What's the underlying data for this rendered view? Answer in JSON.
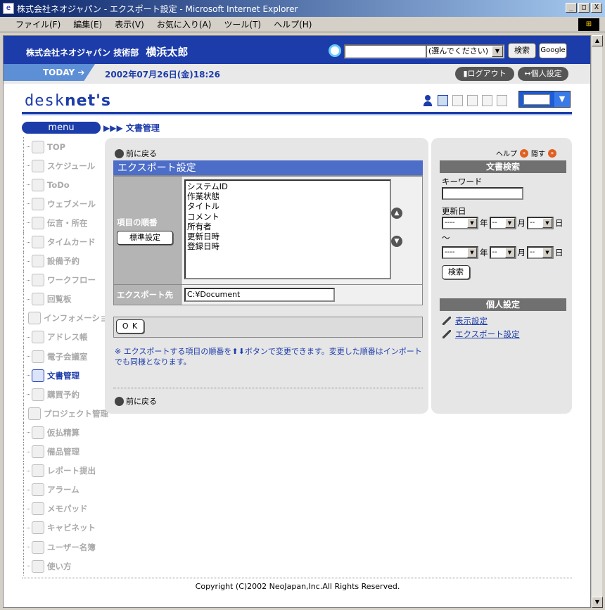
{
  "window": {
    "title": "株式会社ネオジャパン - エクスポート設定 - Microsoft Internet Explorer",
    "controls": [
      "_",
      "□",
      "X"
    ]
  },
  "menubar": [
    "ファイル(F)",
    "編集(E)",
    "表示(V)",
    "お気に入り(A)",
    "ツール(T)",
    "ヘルプ(H)"
  ],
  "header": {
    "company": "株式会社ネオジャパン",
    "department": "技術部",
    "user": "横浜太郎",
    "search_select": "(選んでください)",
    "search_button": "検索",
    "google_button": "Google"
  },
  "today": {
    "label": "TODAY",
    "datetime": "2002年07月26日(金)18:26",
    "logout": "ログアウト",
    "personal_settings": "個人設定"
  },
  "logo": {
    "text_light": "desk",
    "text_bold": "net's"
  },
  "menu_label": "menu",
  "breadcrumb": "▶▶▶ 文書管理",
  "nav": [
    {
      "label": "TOP",
      "icon": "home-icon"
    },
    {
      "label": "スケジュール",
      "icon": "calendar-icon"
    },
    {
      "label": "ToDo",
      "icon": "todo-icon"
    },
    {
      "label": "ウェブメール",
      "icon": "mail-icon"
    },
    {
      "label": "伝言・所在",
      "icon": "person-icon"
    },
    {
      "label": "タイムカード",
      "icon": "clock-icon"
    },
    {
      "label": "設備予約",
      "icon": "facility-icon"
    },
    {
      "label": "ワークフロー",
      "icon": "workflow-icon"
    },
    {
      "label": "回覧板",
      "icon": "circular-icon"
    },
    {
      "label": "インフォメーション",
      "icon": "info-icon"
    },
    {
      "label": "アドレス帳",
      "icon": "address-book-icon"
    },
    {
      "label": "電子会議室",
      "icon": "conference-icon"
    },
    {
      "label": "文書管理",
      "icon": "document-icon",
      "active": true
    },
    {
      "label": "購買予約",
      "icon": "cart-icon"
    },
    {
      "label": "プロジェクト管理",
      "icon": "project-icon"
    },
    {
      "label": "仮払精算",
      "icon": "expense-icon"
    },
    {
      "label": "備品管理",
      "icon": "equipment-icon"
    },
    {
      "label": "レポート提出",
      "icon": "report-icon"
    },
    {
      "label": "アラーム",
      "icon": "alarm-icon"
    },
    {
      "label": "メモパッド",
      "icon": "memo-icon"
    },
    {
      "label": "キャビネット",
      "icon": "cabinet-icon"
    },
    {
      "label": "ユーザー名簿",
      "icon": "user-list-icon"
    },
    {
      "label": "使い方",
      "icon": "help-icon"
    }
  ],
  "main": {
    "back_label": "前に戻る",
    "section_title": "エクスポート設定",
    "order_label": "項目の順番",
    "standard_button": "標準設定",
    "items": [
      "システムID",
      "作業状態",
      "タイトル",
      "コメント",
      "所有者",
      "更新日時",
      "登録日時"
    ],
    "export_label": "エクスポート先",
    "export_path": "C:¥Document",
    "ok_button": "O K",
    "note_mark": "※",
    "note_part1": "エクスポートする項目の順番を",
    "note_part2": "ボタンで変更できます。変更した順番はインポートでも同様となります。"
  },
  "right": {
    "help": "ヘルプ",
    "hide": "隠す",
    "doc_search_title": "文書検索",
    "keyword_label": "キーワード",
    "update_label": "更新日",
    "year": "年",
    "month": "月",
    "day": "日",
    "tilde": "～",
    "year_placeholder": "----",
    "md_placeholder": "--",
    "search_button": "検索",
    "personal_title": "個人設定",
    "display_settings": "表示設定",
    "export_settings": "エクスポート設定"
  },
  "footer": {
    "copyright": "Copyright (C)2002 NeoJapan,Inc.All Rights Reserved."
  }
}
